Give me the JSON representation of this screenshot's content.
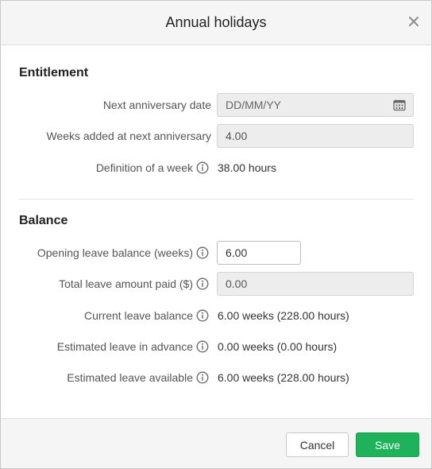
{
  "dialog": {
    "title": "Annual holidays",
    "close_icon": "close-icon"
  },
  "entitlement": {
    "heading": "Entitlement",
    "next_anniversary_label": "Next anniversary date",
    "next_anniversary_placeholder": "DD/MM/YY",
    "weeks_added_label": "Weeks added at next anniversary",
    "weeks_added_value": "4.00",
    "definition_label": "Definition of a week",
    "definition_value": "38.00 hours"
  },
  "balance": {
    "heading": "Balance",
    "opening_label": "Opening leave balance (weeks)",
    "opening_value": "6.00",
    "total_paid_label": "Total leave amount paid ($)",
    "total_paid_value": "0.00",
    "current_label": "Current leave balance",
    "current_value": "6.00 weeks (228.00 hours)",
    "advance_label": "Estimated leave in advance",
    "advance_value": "0.00 weeks (0.00 hours)",
    "available_label": "Estimated leave available",
    "available_value": "6.00 weeks (228.00 hours)"
  },
  "footer": {
    "cancel_label": "Cancel",
    "save_label": "Save"
  },
  "colors": {
    "save_button": "#1eb35a",
    "header_bg": "#f5f5f5",
    "disabled_field_bg": "#ededed"
  }
}
